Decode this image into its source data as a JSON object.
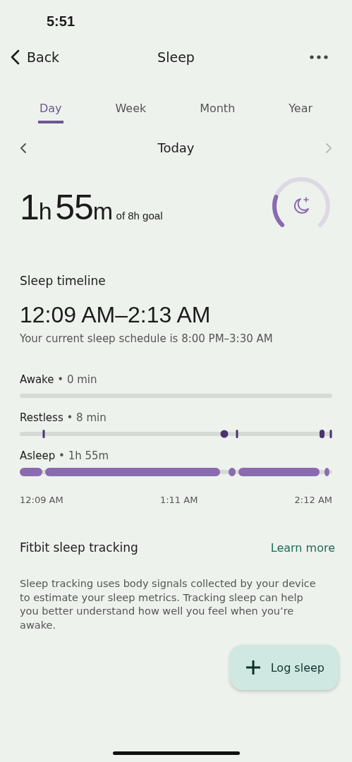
{
  "status_bar": {
    "time": "5:51"
  },
  "header": {
    "back": "Back",
    "title": "Sleep"
  },
  "tabs": [
    {
      "label": "Day",
      "selected": true
    },
    {
      "label": "Week",
      "selected": false
    },
    {
      "label": "Month",
      "selected": false
    },
    {
      "label": "Year",
      "selected": false
    }
  ],
  "date_nav": {
    "label": "Today",
    "next_disabled": true
  },
  "summary": {
    "hours": "1",
    "hours_unit": "h",
    "minutes": "55",
    "minutes_unit": "m",
    "goal": "of 8h goal"
  },
  "timeline": {
    "title": "Sleep timeline",
    "range": "12:09 AM–2:13 AM",
    "schedule": "Your current sleep schedule is 8:00 PM–3:30 AM",
    "stages": [
      {
        "kind": "awake",
        "name": "Awake",
        "value": "• 0 min"
      },
      {
        "kind": "restless",
        "name": "Restless",
        "value": "• 8 min"
      },
      {
        "kind": "asleep",
        "name": "Asleep",
        "value": "• 1h 55m"
      }
    ],
    "axis": [
      "12:09 AM",
      "1:11 AM",
      "2:12 AM"
    ]
  },
  "info": {
    "title": "Fitbit sleep tracking",
    "link": "Learn more",
    "text": "Sleep tracking uses body signals collected by your device to estimate your sleep metrics. Tracking sleep can help you better understand how well you feel when you’re awake."
  },
  "fab": {
    "label": "Log sleep"
  }
}
